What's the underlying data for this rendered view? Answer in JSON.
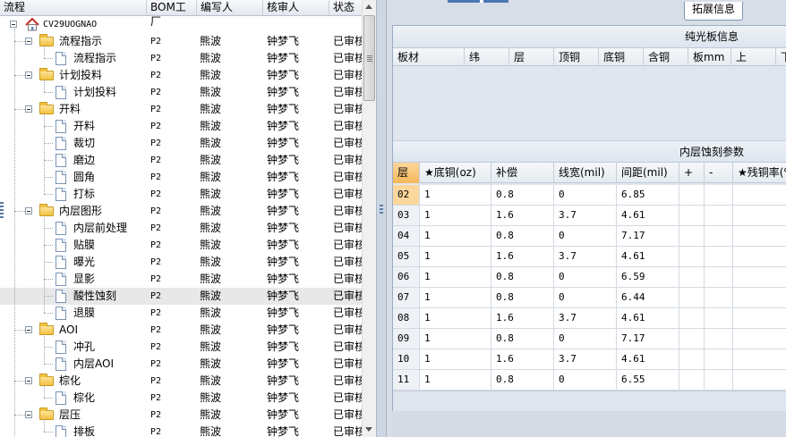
{
  "tree": {
    "columns": [
      "流程",
      "BOM工厂",
      "编写人",
      "核审人",
      "状态"
    ],
    "root": "CV29UOGNAO",
    "rows": [
      {
        "level": 1,
        "type": "folder",
        "name": "流程指示",
        "bom": "P2",
        "writer": "熊波",
        "reviewer": "钟梦飞",
        "status": "已审核"
      },
      {
        "level": 2,
        "type": "doc",
        "name": "流程指示",
        "bom": "P2",
        "writer": "熊波",
        "reviewer": "钟梦飞",
        "status": "已审核"
      },
      {
        "level": 1,
        "type": "folder",
        "name": "计划投料",
        "bom": "P2",
        "writer": "熊波",
        "reviewer": "钟梦飞",
        "status": "已审核"
      },
      {
        "level": 2,
        "type": "doc",
        "name": "计划投料",
        "bom": "P2",
        "writer": "熊波",
        "reviewer": "钟梦飞",
        "status": "已审核"
      },
      {
        "level": 1,
        "type": "folder",
        "name": "开料",
        "bom": "P2",
        "writer": "熊波",
        "reviewer": "钟梦飞",
        "status": "已审核"
      },
      {
        "level": 2,
        "type": "doc",
        "name": "开料",
        "bom": "P2",
        "writer": "熊波",
        "reviewer": "钟梦飞",
        "status": "已审核"
      },
      {
        "level": 2,
        "type": "doc",
        "name": "裁切",
        "bom": "P2",
        "writer": "熊波",
        "reviewer": "钟梦飞",
        "status": "已审核"
      },
      {
        "level": 2,
        "type": "doc",
        "name": "磨边",
        "bom": "P2",
        "writer": "熊波",
        "reviewer": "钟梦飞",
        "status": "已审核"
      },
      {
        "level": 2,
        "type": "doc",
        "name": "圆角",
        "bom": "P2",
        "writer": "熊波",
        "reviewer": "钟梦飞",
        "status": "已审核"
      },
      {
        "level": 2,
        "type": "doc",
        "name": "打标",
        "bom": "P2",
        "writer": "熊波",
        "reviewer": "钟梦飞",
        "status": "已审核"
      },
      {
        "level": 1,
        "type": "folder",
        "name": "内层图形",
        "bom": "P2",
        "writer": "熊波",
        "reviewer": "钟梦飞",
        "status": "已审核"
      },
      {
        "level": 2,
        "type": "doc",
        "name": "内层前处理",
        "bom": "P2",
        "writer": "熊波",
        "reviewer": "钟梦飞",
        "status": "已审核"
      },
      {
        "level": 2,
        "type": "doc",
        "name": "贴膜",
        "bom": "P2",
        "writer": "熊波",
        "reviewer": "钟梦飞",
        "status": "已审核"
      },
      {
        "level": 2,
        "type": "doc",
        "name": "曝光",
        "bom": "P2",
        "writer": "熊波",
        "reviewer": "钟梦飞",
        "status": "已审核"
      },
      {
        "level": 2,
        "type": "doc",
        "name": "显影",
        "bom": "P2",
        "writer": "熊波",
        "reviewer": "钟梦飞",
        "status": "已审核"
      },
      {
        "level": 2,
        "type": "doc",
        "name": "酸性蚀刻",
        "bom": "P2",
        "writer": "熊波",
        "reviewer": "钟梦飞",
        "status": "已审核",
        "selected": true
      },
      {
        "level": 2,
        "type": "doc",
        "name": "退膜",
        "bom": "P2",
        "writer": "熊波",
        "reviewer": "钟梦飞",
        "status": "已审核"
      },
      {
        "level": 1,
        "type": "folder",
        "name": "AOI",
        "bom": "P2",
        "writer": "熊波",
        "reviewer": "钟梦飞",
        "status": "已审核"
      },
      {
        "level": 2,
        "type": "doc",
        "name": "冲孔",
        "bom": "P2",
        "writer": "熊波",
        "reviewer": "钟梦飞",
        "status": "已审核"
      },
      {
        "level": 2,
        "type": "doc",
        "name": "内层AOI",
        "bom": "P2",
        "writer": "熊波",
        "reviewer": "钟梦飞",
        "status": "已审核"
      },
      {
        "level": 1,
        "type": "folder",
        "name": "棕化",
        "bom": "P2",
        "writer": "熊波",
        "reviewer": "钟梦飞",
        "status": "已审核"
      },
      {
        "level": 2,
        "type": "doc",
        "name": "棕化",
        "bom": "P2",
        "writer": "熊波",
        "reviewer": "钟梦飞",
        "status": "已审核"
      },
      {
        "level": 1,
        "type": "folder",
        "name": "层压",
        "bom": "P2",
        "writer": "熊波",
        "reviewer": "钟梦飞",
        "status": "已审核"
      },
      {
        "level": 2,
        "type": "doc",
        "name": "排板",
        "bom": "P2",
        "writer": "熊波",
        "reviewer": "钟梦飞",
        "status": "已审核"
      }
    ]
  },
  "right": {
    "extension_tab": "拓展信息",
    "bare_board": {
      "title": "纯光板信息",
      "columns": [
        "板材",
        "纬",
        "层",
        "顶铜",
        "底铜",
        "含铜",
        "板mm",
        "上",
        "下"
      ]
    },
    "etch": {
      "title": "内层蚀刻参数",
      "columns": [
        "层",
        "★底铜(oz)",
        "补偿",
        "线宽(mil)",
        "间距(mil)",
        "+",
        "-",
        "★残铜率(%)"
      ],
      "rows": [
        {
          "layer": "02",
          "base": "1",
          "comp": "0.8",
          "width": "0",
          "space": "6.85"
        },
        {
          "layer": "03",
          "base": "1",
          "comp": "1.6",
          "width": "3.7",
          "space": "4.61"
        },
        {
          "layer": "04",
          "base": "1",
          "comp": "0.8",
          "width": "0",
          "space": "7.17"
        },
        {
          "layer": "05",
          "base": "1",
          "comp": "1.6",
          "width": "3.7",
          "space": "4.61"
        },
        {
          "layer": "06",
          "base": "1",
          "comp": "0.8",
          "width": "0",
          "space": "6.59"
        },
        {
          "layer": "07",
          "base": "1",
          "comp": "0.8",
          "width": "0",
          "space": "6.44"
        },
        {
          "layer": "08",
          "base": "1",
          "comp": "1.6",
          "width": "3.7",
          "space": "4.61"
        },
        {
          "layer": "09",
          "base": "1",
          "comp": "0.8",
          "width": "0",
          "space": "7.17"
        },
        {
          "layer": "10",
          "base": "1",
          "comp": "1.6",
          "width": "3.7",
          "space": "4.61"
        },
        {
          "layer": "11",
          "base": "1",
          "comp": "0.8",
          "width": "0",
          "space": "6.55"
        }
      ]
    }
  },
  "colors": {
    "accent": "#4d78b5",
    "selection": "#e8e8e8",
    "header_orange": "#f5b85a"
  }
}
